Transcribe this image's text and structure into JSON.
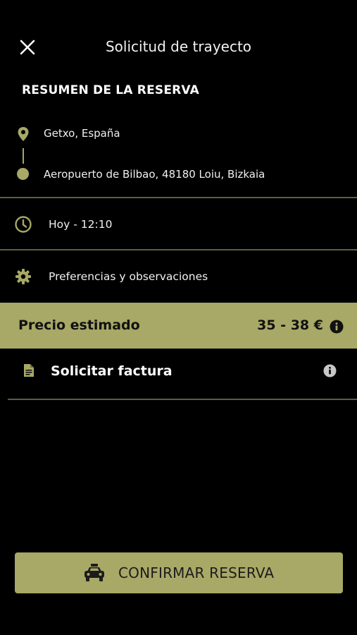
{
  "header": {
    "title": "Solicitud de trayecto",
    "close_icon": "close-icon"
  },
  "summary": {
    "title": "RESUMEN DE LA RESERVA",
    "origin": "Getxo, España",
    "destination": "Aeropuerto de Bilbao, 48180 Loiu, Bizkaia"
  },
  "schedule": {
    "icon": "clock-icon",
    "label": "Hoy - 12:10"
  },
  "preferences": {
    "icon": "gear-icon",
    "label": "Preferencias y observaciones"
  },
  "price": {
    "label": "Precio estimado",
    "value": "35 - 38 €",
    "icon": "info-icon"
  },
  "invoice": {
    "icon": "document-icon",
    "label": "Solicitar factura",
    "info_icon": "info-icon"
  },
  "confirm": {
    "icon": "taxi-icon",
    "label": "CONFIRMAR RESERVA"
  },
  "colors": {
    "accent": "#a8a867",
    "background": "#000000",
    "divider": "#5d5f3c"
  }
}
